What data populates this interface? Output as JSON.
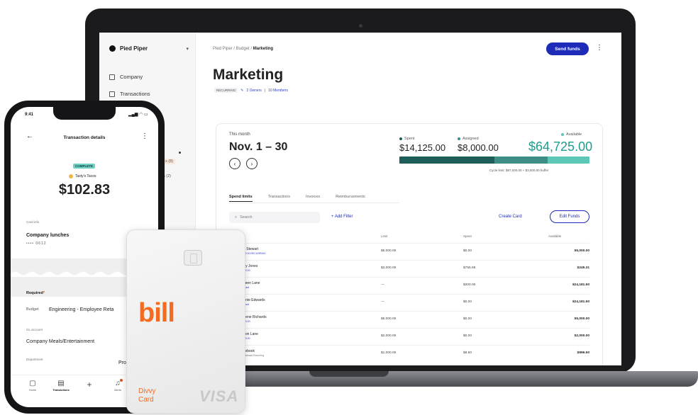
{
  "laptop": {
    "sidebar": {
      "org_name": "Pied Piper",
      "items": [
        {
          "label": "Company"
        },
        {
          "label": "Transactions"
        }
      ],
      "sub_items": [
        {
          "label": "s (8)"
        },
        {
          "label": "s (2)"
        }
      ]
    },
    "header": {
      "breadcrumb": {
        "part1": "Pied Piper",
        "sep1": " / ",
        "part2": "Budget",
        "sep2": " / ",
        "current": "Marketing"
      },
      "send_funds_label": "Send funds",
      "title": "Marketing",
      "recurring_badge": "RECURRING",
      "owners": "2 Owners",
      "members": "10 Members",
      "meta_sep": "|"
    },
    "summary": {
      "this_month_label": "This month",
      "period": "Nov. 1 – 30",
      "spent_label": "Spent",
      "spent_value": "$14,125.00",
      "assigned_label": "Assigned",
      "assigned_value": "$8,000.00",
      "available_label": "Available",
      "available_value": "$64,725.00",
      "spent_fraction": 0.5,
      "assigned_fraction": 0.28,
      "cycle_text": "Cycle limit: $87,000.00 + $3,000.00 buffer"
    },
    "tabs": [
      {
        "label": "Spend limits",
        "active": true
      },
      {
        "label": "Transactions",
        "active": false
      },
      {
        "label": "Invoices",
        "active": false
      },
      {
        "label": "Reimbursements",
        "active": false
      }
    ],
    "toolbar": {
      "search_placeholder": "Search",
      "add_filter_label": "+ Add Filter",
      "create_card_label": "Create Card",
      "edit_funds_label": "Edit Funds"
    },
    "table": {
      "headers": {
        "name": "Name",
        "limit": "Limit",
        "spent": "Spent",
        "available": "Available"
      },
      "rows": [
        {
          "name": "Ann Stewart",
          "sub": "$1,000.00 RECURRING",
          "limit": "$5,000.00",
          "spent": "$0.00",
          "available": "$5,000.00"
        },
        {
          "name": "Cody Jones",
          "sub": "$1,000.00",
          "limit": "$3,000.00",
          "spent": "$755.69",
          "available": "$245.31"
        },
        {
          "name": "Colleen Lane",
          "sub": "Standard",
          "limit": "—",
          "spent": "$300.00",
          "available": "$24,181.50"
        },
        {
          "name": "Connie Edwards",
          "sub": "Standard",
          "limit": "—",
          "spent": "$0.00",
          "available": "$24,181.50"
        },
        {
          "name": "Darlene Richards",
          "sub": "$1,000.00",
          "limit": "$5,000.00",
          "spent": "$0.00",
          "available": "$5,000.00"
        },
        {
          "name": "Devon Lane",
          "sub": "$1,000.00",
          "limit": "$2,000.00",
          "spent": "$0.00",
          "available": "$2,000.00"
        },
        {
          "name": "Facebook",
          "sub": "Ann Stewart Recurring",
          "limit": "$1,000.00",
          "spent": "$8.50",
          "available": "$996.50"
        }
      ]
    }
  },
  "phone": {
    "time": "9:41",
    "status_icons": "▂▄▆ ◠ ▭",
    "title": "Transaction details",
    "status_badge": "COMPLETE",
    "merchant": "Tasty's Tacos",
    "amount": "$102.83",
    "card_info_label": "Card info",
    "card_name": "Company lunches",
    "card_digits": "•••• 0612",
    "required_label": "Required",
    "required_mark": "*",
    "budget_label": "Budget",
    "budget_value": "Engineering - Employee Reta",
    "gl_label": "GL account",
    "gl_value": "Company Meals/Entertainment",
    "department_label": "Department",
    "department_value": "Prod",
    "tabbar": [
      {
        "label": "Home"
      },
      {
        "label": "Transactions"
      },
      {
        "label": ""
      },
      {
        "label": "Alerts"
      }
    ]
  },
  "card": {
    "brand": "bill",
    "product_line1": "Divvy",
    "product_line2": "Card",
    "network": "VISA"
  },
  "colors": {
    "accent_blue": "#1d2bb8",
    "available_teal": "#1f9c8c",
    "spent_dark": "#1d5e58",
    "bill_orange": "#f26b21"
  }
}
